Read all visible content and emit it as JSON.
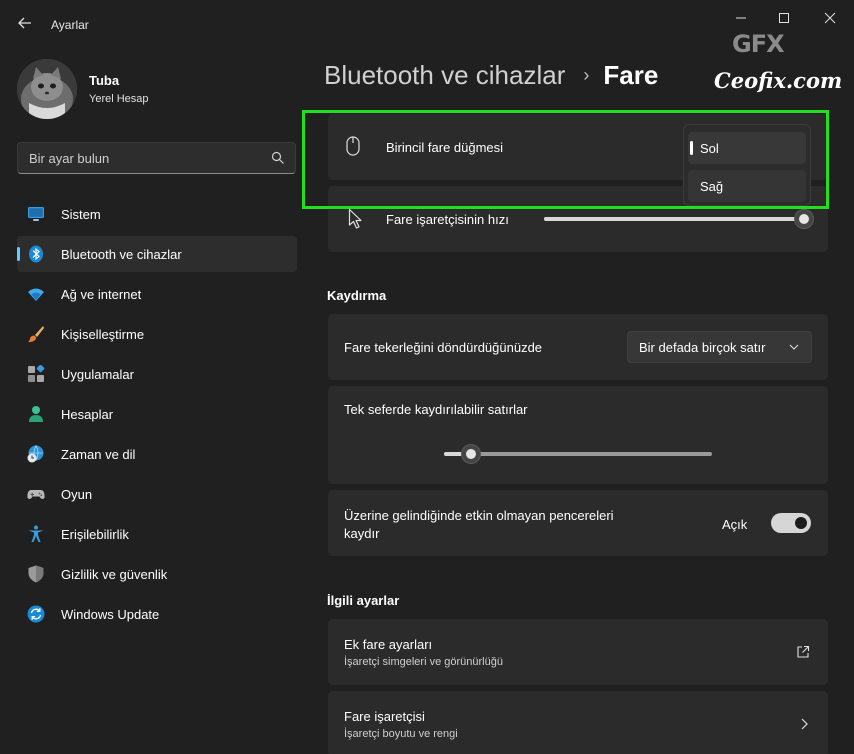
{
  "app": {
    "title": "Ayarlar",
    "window_controls": [
      "minimize-icon",
      "maximize-icon",
      "close-icon"
    ]
  },
  "profile": {
    "name": "Tuba",
    "account_type": "Yerel Hesap"
  },
  "search": {
    "placeholder": "Bir ayar bulun"
  },
  "sidebar": {
    "items": [
      {
        "label": "Sistem",
        "icon": "monitor-icon",
        "active": false
      },
      {
        "label": "Bluetooth ve cihazlar",
        "icon": "bluetooth-icon",
        "active": true
      },
      {
        "label": "Ağ ve internet",
        "icon": "wifi-icon",
        "active": false
      },
      {
        "label": "Kişiselleştirme",
        "icon": "paintbrush-icon",
        "active": false
      },
      {
        "label": "Uygulamalar",
        "icon": "apps-icon",
        "active": false
      },
      {
        "label": "Hesaplar",
        "icon": "person-icon",
        "active": false
      },
      {
        "label": "Zaman ve dil",
        "icon": "globe-clock-icon",
        "active": false
      },
      {
        "label": "Oyun",
        "icon": "gamepad-icon",
        "active": false
      },
      {
        "label": "Erişilebilirlik",
        "icon": "accessibility-icon",
        "active": false
      },
      {
        "label": "Gizlilik ve güvenlik",
        "icon": "shield-icon",
        "active": false
      },
      {
        "label": "Windows Update",
        "icon": "update-icon",
        "active": false
      }
    ]
  },
  "breadcrumb": {
    "parent": "Bluetooth ve cihazlar",
    "current": "Fare"
  },
  "watermark": {
    "logo": "GFX",
    "text": "Ceofix.com"
  },
  "mouse": {
    "primary_button": {
      "label": "Birincil fare düğmesi",
      "icon": "mouse-icon",
      "options": [
        "Sol",
        "Sağ"
      ],
      "selected": "Sol"
    },
    "pointer_speed": {
      "label": "Fare işaretçisinin hızı",
      "icon": "pointer-icon",
      "value_fraction": 0.97
    }
  },
  "scrolling": {
    "section_title": "Kaydırma",
    "wheel": {
      "label": "Fare tekerleğini döndürdüğünüzde",
      "value": "Bir defada birçok satır"
    },
    "lines": {
      "label": "Tek seferde kaydırılabilir satırlar",
      "value_fraction": 0.1
    },
    "inactive": {
      "label_line1": "Üzerine gelindiğinde etkin olmayan pencereleri",
      "label_line2": "kaydır",
      "state": "Açık",
      "on": true
    }
  },
  "related": {
    "section_title": "İlgili ayarlar",
    "items": [
      {
        "title": "Ek fare ayarları",
        "subtitle": "İşaretçi simgeleri ve görünürlüğü",
        "icon": "external-link-icon"
      },
      {
        "title": "Fare işaretçisi",
        "subtitle": "İşaretçi boyutu ve rengi",
        "icon": "chevron-right-icon"
      }
    ]
  },
  "colors": {
    "background": "#202020",
    "card": "#2b2b2b",
    "accent": "#60cdff",
    "highlight_box": "#22e01c"
  }
}
